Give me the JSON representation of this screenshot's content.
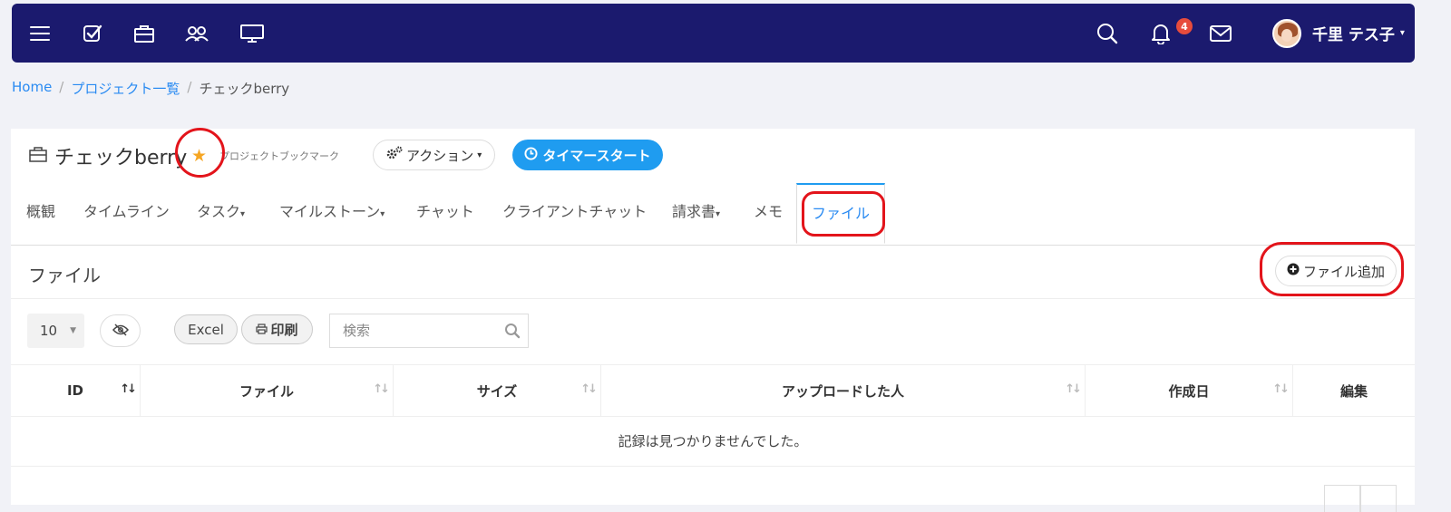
{
  "topbar": {
    "icons": [
      "menu-icon",
      "checklist-icon",
      "briefcase-icon",
      "users-icon",
      "monitor-icon",
      "search-icon",
      "bell-icon",
      "mail-icon"
    ],
    "notification_count": "4",
    "user_name": "千里 テス子"
  },
  "breadcrumb": {
    "home": "Home",
    "projects": "プロジェクト一覧",
    "current": "チェックberry"
  },
  "project": {
    "title": "チェックberry",
    "bookmark_label": "プロジェクトブックマーク",
    "action_label": "アクション",
    "timer_label": "タイマースタート"
  },
  "tabs": [
    "概観",
    "タイムライン",
    "タスク",
    "マイルストーン",
    "チャット",
    "クライアントチャット",
    "請求書",
    "メモ",
    "ファイル"
  ],
  "files": {
    "section_title": "ファイル",
    "add_label": "ファイル追加",
    "page_length": "10",
    "excel_label": "Excel",
    "print_label": "印刷",
    "search_placeholder": "検索",
    "columns": [
      "ID",
      "ファイル",
      "サイズ",
      "アップロードした人",
      "作成日",
      "編集"
    ],
    "empty_message": "記録は見つかりませんでした。"
  },
  "colors": {
    "topbar": "#1b1a6e",
    "accent": "#1f9cf0",
    "annotation": "#e3141b",
    "star": "#f6a623"
  }
}
